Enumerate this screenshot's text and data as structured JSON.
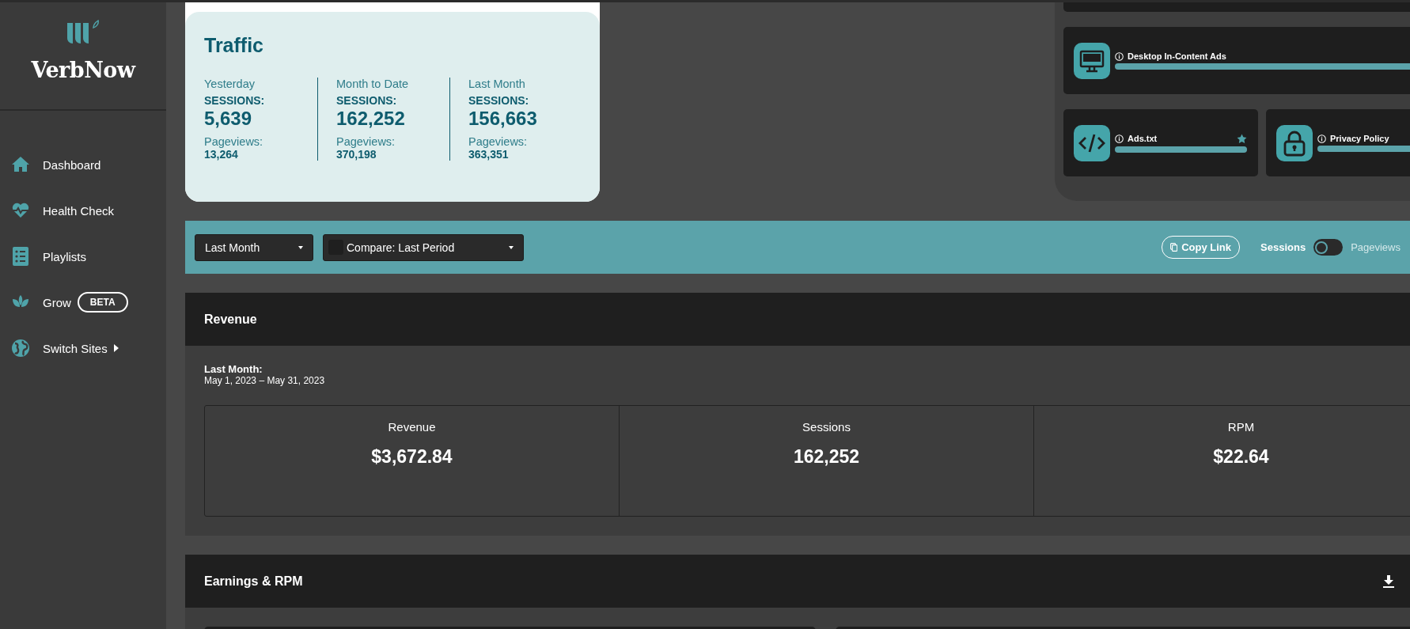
{
  "sidebar": {
    "brand": "VerbNow",
    "items": [
      {
        "label": "Dashboard",
        "kind": "home"
      },
      {
        "label": "Health Check",
        "kind": "heart"
      },
      {
        "label": "Playlists",
        "kind": "list"
      },
      {
        "label": "Grow",
        "kind": "leaf",
        "badge": "BETA"
      },
      {
        "label": "Switch Sites",
        "kind": "globe",
        "submenu": true
      }
    ]
  },
  "traffic": {
    "title": "Traffic",
    "periods": [
      {
        "period": "Yesterday",
        "sessions_label": "SESSIONS:",
        "sessions": "5,639",
        "pageviews_label": "Pageviews:",
        "pageviews": "13,264"
      },
      {
        "period": "Month to Date",
        "sessions_label": "SESSIONS:",
        "sessions": "162,252",
        "pageviews_label": "Pageviews:",
        "pageviews": "370,198"
      },
      {
        "period": "Last Month",
        "sessions_label": "SESSIONS:",
        "sessions": "156,663",
        "pageviews_label": "Pageviews:",
        "pageviews": "363,351"
      }
    ]
  },
  "health_checks": [
    {
      "name": "Desktop In-Content Ads",
      "kind": "desktop",
      "level": 1,
      "starred": false
    },
    {
      "name": "Ads.txt",
      "kind": "code",
      "level": 1,
      "starred": true
    },
    {
      "name": "Privacy Policy",
      "kind": "lock",
      "level": 1,
      "starred": false
    }
  ],
  "filters": {
    "range": "Last Month",
    "compare": {
      "checked": false,
      "label": "Compare: Last Period"
    },
    "copy_link": "Copy Link",
    "toggle": [
      {
        "label": "Sessions",
        "selected": true
      },
      {
        "label": "Pageviews",
        "selected": false
      }
    ]
  },
  "revenue": {
    "title": "Revenue",
    "period_label": "Last Month:",
    "date_range": "May 1, 2023 – May 31, 2023",
    "stats": [
      {
        "label": "Revenue",
        "value": "$3,672.84"
      },
      {
        "label": "Sessions",
        "value": "162,252"
      },
      {
        "label": "RPM",
        "value": "$22.64"
      }
    ]
  },
  "earnings": {
    "title": "Earnings & RPM"
  }
}
